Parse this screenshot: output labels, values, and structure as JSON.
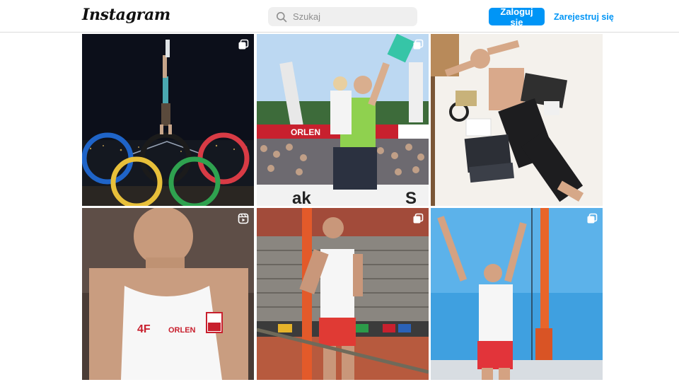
{
  "header": {
    "logo_text": "Instagram",
    "search": {
      "placeholder": "Szukaj",
      "icon": "search-icon"
    },
    "login_label": "Zaloguj się",
    "signup_label": "Zarejestruj się"
  },
  "colors": {
    "accent": "#0095f6",
    "search_bg": "#efefef",
    "border": "#dbdbdb"
  },
  "posts": [
    {
      "badge": "carousel-icon",
      "banner_text": ""
    },
    {
      "badge": "carousel-icon",
      "banner_text": "ORLEN"
    },
    {
      "badge": "",
      "banner_text": ""
    },
    {
      "badge": "reel-icon",
      "banner_text": "ORLEN"
    },
    {
      "badge": "carousel-icon",
      "banner_text": ""
    },
    {
      "badge": "carousel-icon",
      "banner_text": ""
    }
  ]
}
